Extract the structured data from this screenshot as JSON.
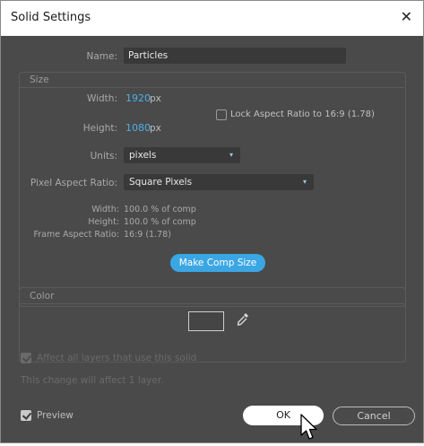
{
  "window": {
    "title": "Solid Settings"
  },
  "name": {
    "label": "Name:",
    "value": "Particles"
  },
  "size": {
    "title": "Size",
    "width_label": "Width:",
    "width_value": "1920",
    "width_unit": "px",
    "height_label": "Height:",
    "height_value": "1080",
    "height_unit": "px",
    "lock_label": "Lock Aspect Ratio to 16:9 (1.78)",
    "lock_checked": false,
    "units_label": "Units:",
    "units_value": "pixels",
    "par_label": "Pixel Aspect Ratio:",
    "par_value": "Square Pixels",
    "info": [
      {
        "label": "Width:",
        "value": "100.0 % of comp"
      },
      {
        "label": "Height:",
        "value": "100.0 % of comp"
      },
      {
        "label": "Frame Aspect Ratio:",
        "value": "16:9 (1.78)"
      }
    ],
    "make_comp_size": "Make Comp Size"
  },
  "color": {
    "title": "Color",
    "swatch": "#454545"
  },
  "affect": {
    "label": "Affect all layers that use this solid",
    "checked": true
  },
  "affect_note": "This change will affect 1 layer.",
  "preview": {
    "label": "Preview",
    "checked": true
  },
  "buttons": {
    "ok": "OK",
    "cancel": "Cancel"
  },
  "colors": {
    "accent": "#3ba6e4",
    "value_blue": "#4fb0e6",
    "background": "#4a4a4a"
  }
}
